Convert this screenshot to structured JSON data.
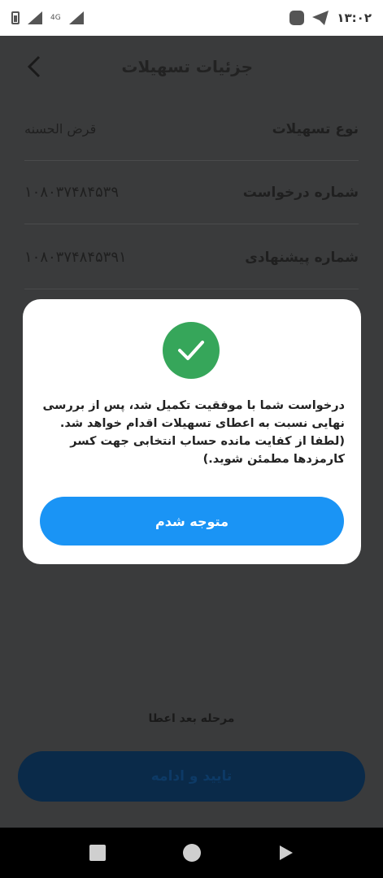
{
  "status_bar": {
    "time": "۱۳:۰۲",
    "network": "4G"
  },
  "header": {
    "title": "جزئیات تسهیلات"
  },
  "details": [
    {
      "label": "نوع تسهیلات",
      "value": "قرض الحسنه"
    },
    {
      "label": "شماره درخواست",
      "value": "۱۰۸۰۳۷۴۸۴۵۳۹"
    },
    {
      "label": "شماره پیشنهادی",
      "value": "۱۰۸۰۳۷۴۸۴۵۳۹۱"
    }
  ],
  "footer": {
    "stage_text": "مرحله بعد اعطا",
    "confirm_label": "تایید و ادامه"
  },
  "modal": {
    "message": "درخواست شما با موفقیت تکمیل شد، پس از بررسی نهایی نسبت به اعطای تسهیلات اقدام خواهد شد. (لطفا از کفایت مانده حساب انتخابی جهت کسر کارمزدها مطمئن شوید.)",
    "ok_label": "متوجه شدم"
  },
  "colors": {
    "success": "#36a65a",
    "primary": "#1a94f5"
  }
}
